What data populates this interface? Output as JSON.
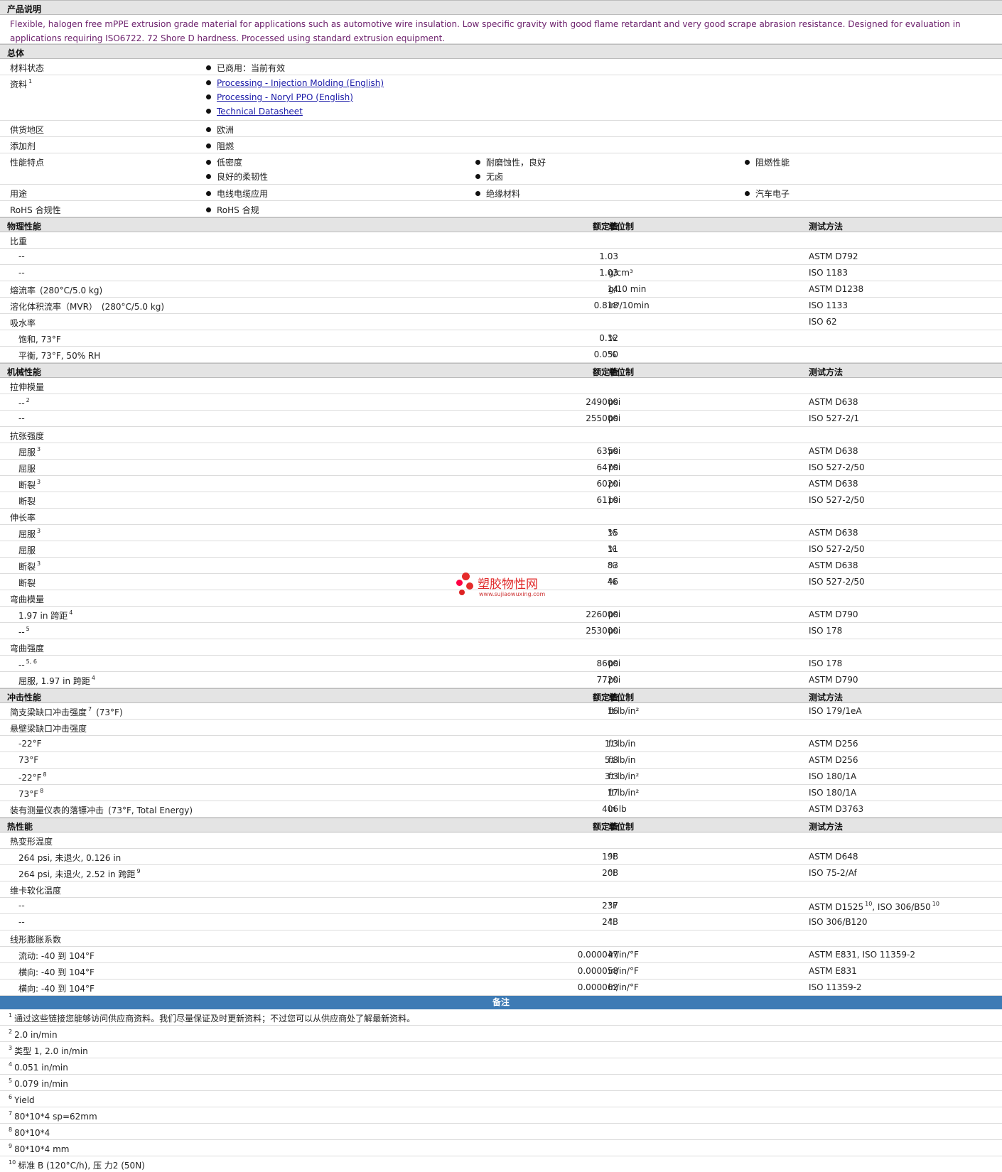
{
  "watermark": {
    "text": "塑胶物性网",
    "url": "www.sujiaowuxing.com"
  },
  "product": {
    "heading": "产品说明",
    "description": "Flexible, halogen free mPPE extrusion grade material for applications such as automotive wire insulation. Low specific gravity with good flame retardant and very good scrape abrasion resistance. Designed for evaluation in applications requiring ISO6722. 72 Shore D hardness. Processed using standard extrusion equipment."
  },
  "general": {
    "heading": "总体",
    "rows": [
      {
        "label": "材料状态",
        "items": [
          [
            "已商用：当前有效"
          ]
        ]
      },
      {
        "label": "资料",
        "sup": "1",
        "links": [
          "Processing - Injection Molding (English)",
          "Processing - Noryl PPO (English)",
          "Technical Datasheet"
        ]
      },
      {
        "label": "供货地区",
        "items": [
          [
            "欧洲"
          ]
        ]
      },
      {
        "label": "添加剂",
        "items": [
          [
            "阻燃"
          ]
        ]
      },
      {
        "label": "性能特点",
        "items": [
          [
            "低密度",
            "良好的柔韧性"
          ],
          [
            "耐磨蚀性，良好",
            "无卤"
          ],
          [
            "阻燃性能"
          ]
        ]
      },
      {
        "label": "用途",
        "items": [
          [
            "电线电缆应用"
          ],
          [
            "绝缘材料"
          ],
          [
            "汽车电子"
          ]
        ]
      },
      {
        "label": "RoHS 合规性",
        "items": [
          [
            "RoHS 合规"
          ]
        ]
      }
    ]
  },
  "headers": {
    "value": "额定值",
    "unit": "单位制",
    "method": "测试方法"
  },
  "sections": [
    {
      "title": "物理性能",
      "rows": [
        {
          "label": "比重",
          "group": true
        },
        {
          "label": "--",
          "sub": true,
          "value": "1.03",
          "unit": "",
          "method": "ASTM D792"
        },
        {
          "label": "--",
          "sub": true,
          "value": "1.03",
          "unit": "g/cm³",
          "method": "ISO 1183"
        },
        {
          "label": "熔流率",
          "cond": "(280°C/5.0 kg)",
          "value": "14",
          "unit": "g/10 min",
          "method": "ASTM D1238"
        },
        {
          "label": "溶化体积流率（MVR）",
          "cond": "(280°C/5.0 kg)",
          "value": "0.818",
          "unit": "in³/10min",
          "method": "ISO 1133"
        },
        {
          "label": "吸水率",
          "group": true,
          "method": "ISO 62"
        },
        {
          "label": "饱和, 73°F",
          "sub": true,
          "value": "0.12",
          "unit": "%",
          "method": ""
        },
        {
          "label": "平衡, 73°F, 50% RH",
          "sub": true,
          "value": "0.050",
          "unit": "%",
          "method": ""
        }
      ]
    },
    {
      "title": "机械性能",
      "rows": [
        {
          "label": "拉伸模量",
          "group": true
        },
        {
          "label": "--",
          "sub": true,
          "sup": "2",
          "value": "249000",
          "unit": "psi",
          "method": "ASTM D638"
        },
        {
          "label": "--",
          "sub": true,
          "value": "255000",
          "unit": "psi",
          "method": "ISO 527-2/1"
        },
        {
          "label": "抗张强度",
          "group": true
        },
        {
          "label": "屈服",
          "sub": true,
          "sup": "3",
          "value": "6350",
          "unit": "psi",
          "method": "ASTM D638"
        },
        {
          "label": "屈服",
          "sub": true,
          "value": "6470",
          "unit": "psi",
          "method": "ISO 527-2/50"
        },
        {
          "label": "断裂",
          "sub": true,
          "sup": "3",
          "value": "6020",
          "unit": "psi",
          "method": "ASTM D638"
        },
        {
          "label": "断裂",
          "sub": true,
          "value": "6110",
          "unit": "psi",
          "method": "ISO 527-2/50"
        },
        {
          "label": "伸长率",
          "group": true
        },
        {
          "label": "屈服",
          "sub": true,
          "sup": "3",
          "value": "15",
          "unit": "%",
          "method": "ASTM D638"
        },
        {
          "label": "屈服",
          "sub": true,
          "value": "11",
          "unit": "%",
          "method": "ISO 527-2/50"
        },
        {
          "label": "断裂",
          "sub": true,
          "sup": "3",
          "value": "83",
          "unit": "%",
          "method": "ASTM D638"
        },
        {
          "label": "断裂",
          "sub": true,
          "value": "46",
          "unit": "%",
          "method": "ISO 527-2/50"
        },
        {
          "label": "弯曲模量",
          "group": true
        },
        {
          "label": "1.97 in 跨距",
          "sub": true,
          "sup": "4",
          "value": "226000",
          "unit": "psi",
          "method": "ASTM D790"
        },
        {
          "label": "--",
          "sub": true,
          "sup": "5",
          "value": "253000",
          "unit": "psi",
          "method": "ISO 178"
        },
        {
          "label": "弯曲强度",
          "group": true
        },
        {
          "label": "--",
          "sub": true,
          "sup": "5, 6",
          "value": "8600",
          "unit": "psi",
          "method": "ISO 178"
        },
        {
          "label": "屈服, 1.97 in 跨距",
          "sub": true,
          "sup": "4",
          "value": "7720",
          "unit": "psi",
          "method": "ASTM D790"
        }
      ]
    },
    {
      "title": "冲击性能",
      "rows": [
        {
          "label": "简支梁缺口冲击强度",
          "sup": "7",
          "cond": "(73°F)",
          "value": "16",
          "unit": "ft·lb/in²",
          "method": "ISO 179/1eA"
        },
        {
          "label": "悬壁梁缺口冲击强度",
          "group": true
        },
        {
          "label": "-22°F",
          "sub": true,
          "value": "1.3",
          "unit": "ft·lb/in",
          "method": "ASTM D256"
        },
        {
          "label": "73°F",
          "sub": true,
          "value": "5.8",
          "unit": "ft·lb/in",
          "method": "ASTM D256"
        },
        {
          "label": "-22°F",
          "sub": true,
          "sup": "8",
          "value": "3.3",
          "unit": "ft·lb/in²",
          "method": "ISO 180/1A"
        },
        {
          "label": "73°F",
          "sub": true,
          "sup": "8",
          "value": "17",
          "unit": "ft·lb/in²",
          "method": "ISO 180/1A"
        },
        {
          "label": "装有测量仪表的落镖冲击",
          "cond": "(73°F, Total Energy)",
          "value": "406",
          "unit": "in·lb",
          "method": "ASTM D3763"
        }
      ]
    },
    {
      "title": "热性能",
      "rows": [
        {
          "label": "热变形温度",
          "group": true
        },
        {
          "label": "264 psi, 未退火, 0.126 in",
          "sub": true,
          "value": "198",
          "unit": "°F",
          "method": "ASTM D648"
        },
        {
          "label": "264 psi, 未退火, 2.52 in 跨距",
          "sub": true,
          "sup": "9",
          "value": "208",
          "unit": "°F",
          "method": "ISO 75-2/Af"
        },
        {
          "label": "维卡软化温度",
          "group": true
        },
        {
          "label": "--",
          "sub": true,
          "value": "237",
          "unit": "°F",
          "method": "ASTM D1525",
          "msup": "10",
          "method2": ", ISO 306/B50",
          "msup2": "10"
        },
        {
          "label": "--",
          "sub": true,
          "value": "243",
          "unit": "°F",
          "method": "ISO 306/B120"
        },
        {
          "label": "线形膨胀系数",
          "group": true
        },
        {
          "label": "流动: -40 到  104°F",
          "sub": true,
          "value": "0.000047",
          "unit": "in/in/°F",
          "method": "ASTM E831, ISO 11359-2"
        },
        {
          "label": "横向: -40 到  104°F",
          "sub": true,
          "value": "0.000058",
          "unit": "in/in/°F",
          "method": "ASTM E831"
        },
        {
          "label": "横向: -40 到  104°F",
          "sub": true,
          "value": "0.000062",
          "unit": "in/in/°F",
          "method": "ISO 11359-2"
        }
      ]
    }
  ],
  "notes": {
    "heading": "备注",
    "items": [
      {
        "n": "1",
        "text": "通过这些链接您能够访问供应商资料。我们尽量保证及时更新资料；不过您可以从供应商处了解最新资料。"
      },
      {
        "n": "2",
        "text": "2.0 in/min"
      },
      {
        "n": "3",
        "text": "类型  1, 2.0 in/min"
      },
      {
        "n": "4",
        "text": "0.051 in/min"
      },
      {
        "n": "5",
        "text": "0.079 in/min"
      },
      {
        "n": "6",
        "text": "Yield"
      },
      {
        "n": "7",
        "text": "80*10*4 sp=62mm"
      },
      {
        "n": "8",
        "text": "80*10*4"
      },
      {
        "n": "9",
        "text": "80*10*4 mm"
      },
      {
        "n": "10",
        "text": "标准  B (120°C/h), 压  力2 (50N)"
      }
    ]
  }
}
